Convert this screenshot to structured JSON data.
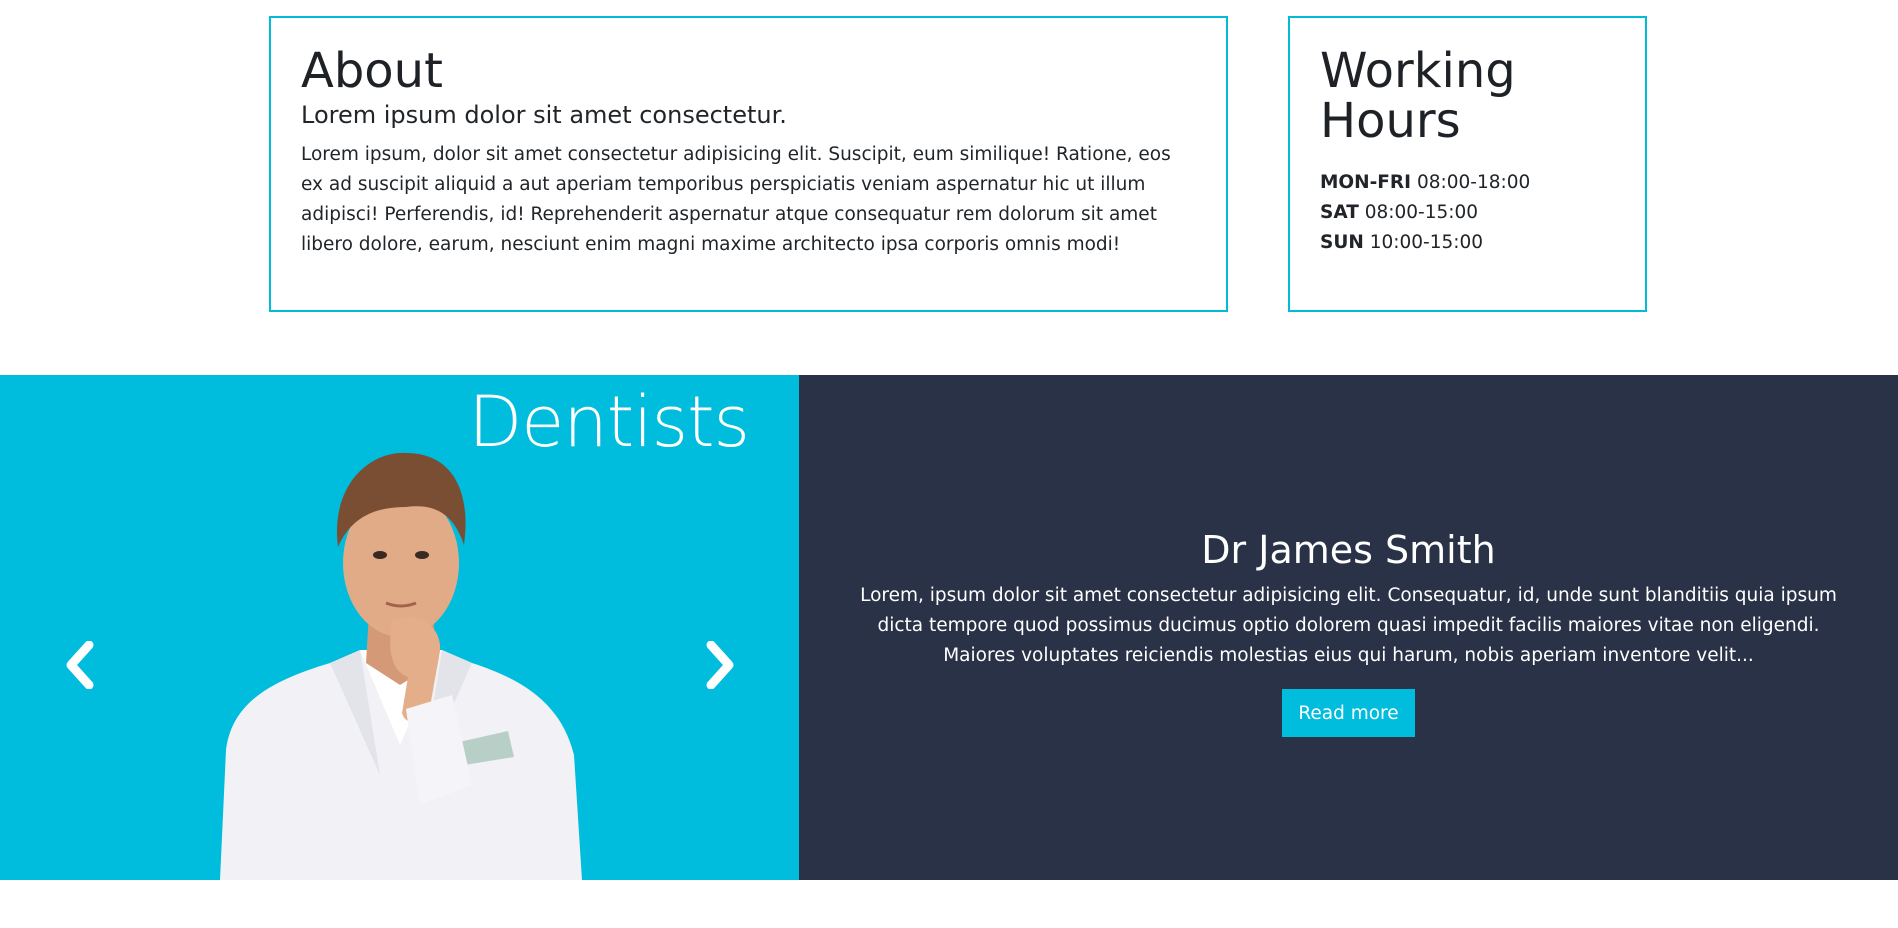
{
  "about": {
    "title": "About",
    "subtitle": "Lorem ipsum dolor sit amet consectetur.",
    "body": "Lorem ipsum, dolor sit amet consectetur adipisicing elit. Suscipit, eum similique! Ratione, eos ex ad suscipit aliquid a aut aperiam temporibus perspiciatis veniam aspernatur hic ut illum adipisci! Perferendis, id! Reprehenderit aspernatur atque consequatur rem dolorum sit amet libero dolore, earum, nesciunt enim magni maxime architecto ipsa corporis omnis modi!"
  },
  "hours": {
    "title": "Working Hours",
    "items": [
      {
        "day": "MON-FRI",
        "time": "08:00-18:00"
      },
      {
        "day": "SAT",
        "time": "08:00-15:00"
      },
      {
        "day": "SUN",
        "time": "10:00-15:00"
      }
    ]
  },
  "dentists": {
    "title": "Dentists",
    "prev_icon": "chevron-left-icon",
    "next_icon": "chevron-right-icon",
    "name": "Dr James Smith",
    "bio": "Lorem, ipsum dolor sit amet consectetur adipisicing elit. Consequatur, id, unde sunt blanditiis quia ipsum dicta tempore quod possimus ducimus optio dolorem quasi impedit facilis maiores vitae non eligendi. Maiores voluptates reiciendis molestias eius qui harum, nobis aperiam inventore velit...",
    "read_more_label": "Read more"
  },
  "colors": {
    "accent": "#00bcdd",
    "dark_panel": "#2a3248",
    "text": "#212529"
  }
}
